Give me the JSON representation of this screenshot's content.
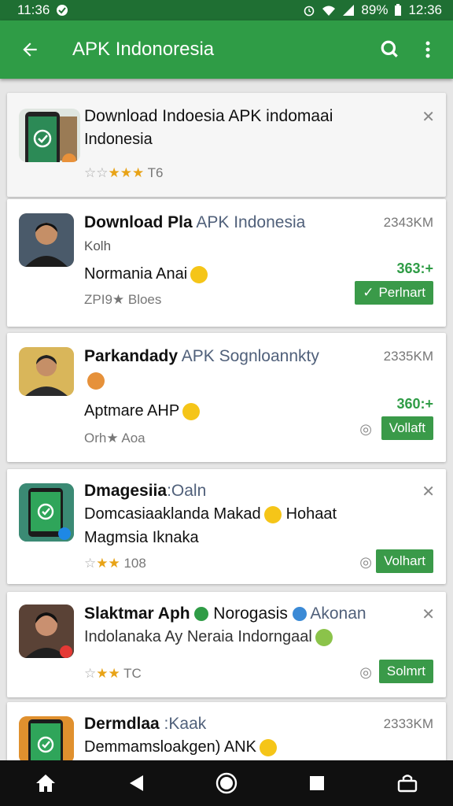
{
  "status_bar": {
    "time_left": "11:36",
    "battery": "89%",
    "time_right": "12:36"
  },
  "app_bar": {
    "title": "APK Indonoresia"
  },
  "cards": [
    {
      "title_bold": "Download",
      "title_rest": " Indoesia APK indomaai",
      "title_line2": "Indonesia",
      "rating": "T6"
    },
    {
      "title_bold": "Download Pla",
      "title_gray": " APK Indonesia",
      "size": "2343KM",
      "sub": "Kolh",
      "line2": "Normania Anai",
      "rating": "ZPI9★ Bloes",
      "count": "363:+",
      "button": "Perlnart"
    },
    {
      "title_bold": "Parkandady",
      "title_gray": " APK Sognloannkty",
      "size": "2335KM",
      "line2": "Aptmare AHP",
      "rating": "Orh★ Aoa",
      "count": "360:+",
      "button": "Vollaft"
    },
    {
      "title_bold": "Dmagesiia",
      "title_gray": ":Oaln",
      "line2": "Domcasiaaklanda Makad",
      "line2b": "Hohaat",
      "line3": "Magmsia Iknaka",
      "rating": "108",
      "button": "Volhart"
    },
    {
      "title_bold": "Slaktmar Aph",
      "title_rest": " Norogasis",
      "title_gray": " Akonan",
      "line2": "Indolanaka Ay Neraia Indorngaal",
      "rating": "TC",
      "button": "Solmrt"
    },
    {
      "title_bold": "Dermdlaa",
      "title_gray": " :Kaak",
      "size": "2333KM",
      "line2": "Demmamsloakgen) ANK"
    }
  ],
  "icons": {
    "back": "arrow-left-icon",
    "search": "search-icon",
    "more": "more-vert-icon",
    "home": "home-icon",
    "nav_back": "nav-back-icon",
    "nav_home": "nav-home-icon",
    "recents": "recents-icon",
    "keyboard": "keyboard-icon"
  },
  "colors": {
    "status_bar": "#1f6f33",
    "app_bar": "#2f9c46",
    "button": "#3a9a49",
    "star": "#e8a317"
  }
}
